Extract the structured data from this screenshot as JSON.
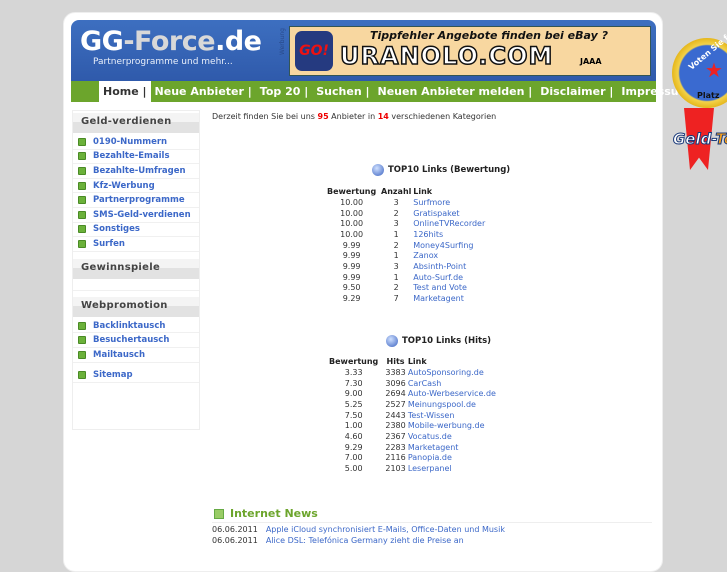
{
  "header": {
    "logo_a": "GG",
    "logo_b": "-Force",
    "logo_c": ".de",
    "slogan": "Partnerprogramme und mehr...",
    "ad_label": "Werbung",
    "banner": {
      "go": "GO!",
      "tagline": "Tippfehler Angebote finden bei eBay ?",
      "brand": "URANOLO.COM",
      "shout": "JAAA"
    }
  },
  "nav": [
    "Home |",
    "Neue Anbieter |",
    "Top 20 |",
    "Suchen |",
    "Neuen Anbieter melden |",
    "Disclaimer |",
    "Impressum"
  ],
  "sidebar": {
    "geld_title": "Geld-verdienen",
    "geld": [
      "0190-Nummern",
      "Bezahlte-Emails",
      "Bezahlte-Umfragen",
      "Kfz-Werbung",
      "Partnerprogramme",
      "SMS-Geld-verdienen",
      "Sonstiges",
      "Surfen"
    ],
    "gewinn_title": "Gewinnspiele",
    "web_title": "Webpromotion",
    "web": [
      "Backlinktausch",
      "Besuchertausch",
      "Mailtausch"
    ],
    "sitemap": "Sitemap"
  },
  "intro": {
    "a": "Derzeit finden Sie bei uns ",
    "count": "95",
    "b": " Anbieter in ",
    "cats": "14",
    "c": " verschiedenen Kategorien"
  },
  "top_rating": {
    "title": "TOP10 Links (Bewertung)",
    "headers": [
      "Bewertung",
      "Anzahl",
      "Link"
    ],
    "rows": [
      [
        "10.00",
        "3",
        "Surfmore"
      ],
      [
        "10.00",
        "2",
        "Gratispaket"
      ],
      [
        "10.00",
        "3",
        "OnlineTVRecorder"
      ],
      [
        "10.00",
        "1",
        "126hits"
      ],
      [
        "9.99",
        "2",
        "Money4Surfing"
      ],
      [
        "9.99",
        "1",
        "Zanox"
      ],
      [
        "9.99",
        "3",
        "Absinth-Point"
      ],
      [
        "9.99",
        "1",
        "Auto-Surf.de"
      ],
      [
        "9.50",
        "2",
        "Test and Vote"
      ],
      [
        "9.29",
        "7",
        "Marketagent"
      ]
    ]
  },
  "top_hits": {
    "title": "TOP10 Links (Hits)",
    "headers": [
      "Bewertung",
      "Hits",
      "Link"
    ],
    "rows": [
      [
        "3.33",
        "3383",
        "AutoSponsoring.de"
      ],
      [
        "7.30",
        "3096",
        "CarCash"
      ],
      [
        "9.00",
        "2694",
        "Auto-Werbeservice.de"
      ],
      [
        "5.25",
        "2527",
        "Meinungspool.de"
      ],
      [
        "7.50",
        "2443",
        "Test-Wissen"
      ],
      [
        "1.00",
        "2380",
        "Mobile-werbung.de"
      ],
      [
        "4.60",
        "2367",
        "Vocatus.de"
      ],
      [
        "9.29",
        "2283",
        "Marketagent"
      ],
      [
        "7.00",
        "2116",
        "Panopia.de"
      ],
      [
        "5.00",
        "2103",
        "Leserpanel"
      ]
    ]
  },
  "news": {
    "title": "Internet News",
    "items": [
      {
        "date": "06.06.2011",
        "text": "Apple iCloud synchronisiert E-Mails, Office-Daten und Musik"
      },
      {
        "date": "06.06.2011",
        "text": "Alice DSL: Telefónica Germany zieht die Preise an"
      }
    ]
  },
  "badge": {
    "vote": "Voten Sie f",
    "platz": "Platz",
    "brand_a": "Geld-",
    "brand_b": "To"
  }
}
